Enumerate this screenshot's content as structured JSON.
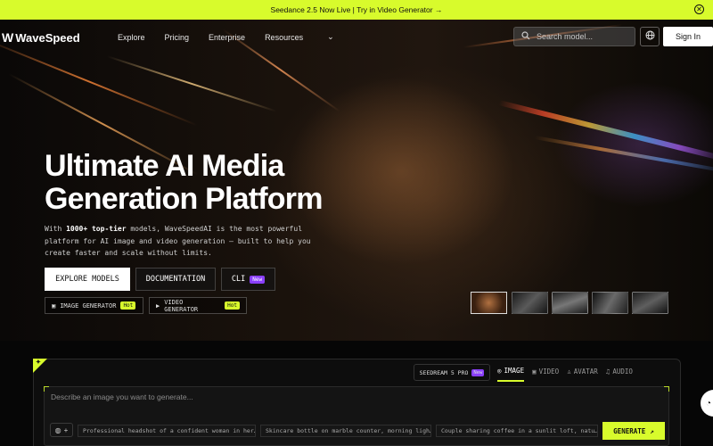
{
  "banner": {
    "text": "Seedance 2.5 Now Live | Try in Video Generator →",
    "close_icon": "close-icon"
  },
  "nav": {
    "logo_mark": "W",
    "logo_text": "WaveSpeed",
    "links": [
      "Explore",
      "Pricing",
      "Enterprise",
      "Resources"
    ],
    "search_placeholder": "Search model...",
    "signin_label": "Sign In"
  },
  "hero": {
    "headline_line1": "Ultimate AI Media",
    "headline_line2": "Generation Platform",
    "desc_prefix": "With ",
    "desc_bold": "1000+ top-tier",
    "desc_rest": " models, WaveSpeedAI is the most powerful platform for AI image and video generation — built to help you create faster and scale without limits.",
    "buttons": {
      "explore": "EXPLORE MODELS",
      "docs": "DOCUMENTATION",
      "cli": "CLI",
      "cli_badge": "New"
    },
    "sub_buttons": {
      "image": "IMAGE GENERATOR",
      "video": "VIDEO GENERATOR",
      "hot": "Hot"
    }
  },
  "generator": {
    "model_label": "SEEDREAM 5 PRO",
    "model_badge": "New",
    "tabs": [
      "IMAGE",
      "VIDEO",
      "AVATAR",
      "AUDIO"
    ],
    "active_tab": "IMAGE",
    "prompt_placeholder": "Describe an image you want to generate...",
    "suggestions": [
      "Professional headshot of a confident woman in her…",
      "Skincare bottle on marble counter, morning ligh…",
      "Couple sharing coffee in a sunlit loft, natu…"
    ],
    "generate_label": "GENERATE"
  },
  "colors": {
    "accent": "#d8fb2c",
    "badge_new": "#8a3ffc",
    "bg": "#060606"
  }
}
